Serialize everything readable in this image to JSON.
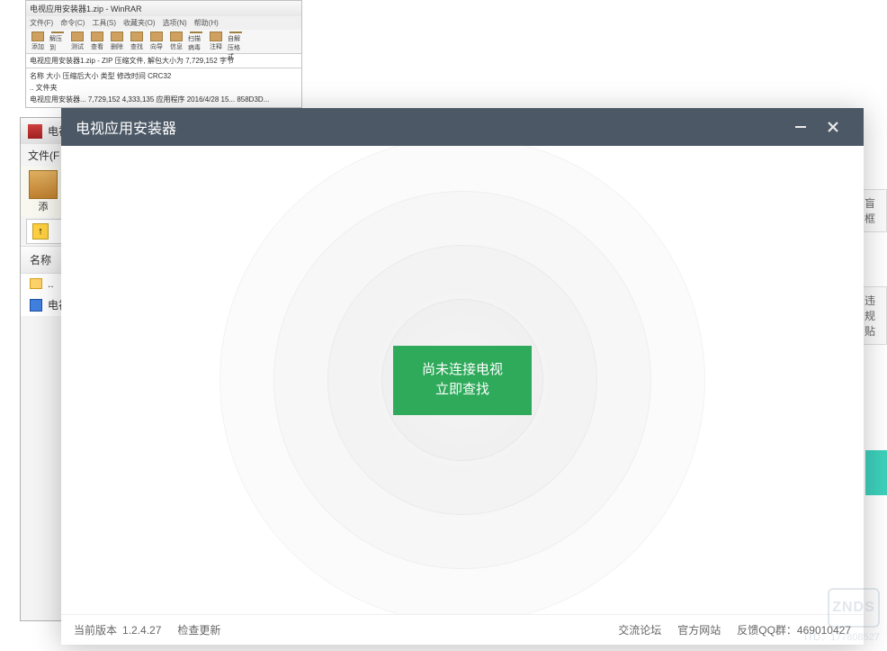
{
  "bg_small": {
    "title": "电视应用安装器1.zip - WinRAR",
    "menu": [
      "文件(F)",
      "命令(C)",
      "工具(S)",
      "收藏夹(O)",
      "选项(N)",
      "帮助(H)"
    ],
    "toolbar": [
      "添加",
      "解压到",
      "测试",
      "查看",
      "删除",
      "查找",
      "向导",
      "信息",
      "扫描病毒",
      "注释",
      "自解压格式"
    ],
    "path": "电视应用安装器1.zip - ZIP 压缩文件, 解包大小为 7,729,152 字节",
    "headers": "名称     大小   压缩后大小   类型         修改时间        CRC32",
    "row1": "..                                   文件夹",
    "row2": "电视应用安装器...   7,729,152   4,333,135   应用程序   2016/4/28 15...   858D3D..."
  },
  "bg_mid": {
    "title": "电视",
    "menu": "文件(F",
    "toolbar_label": "添",
    "header": "名称",
    "row_up": "..",
    "row_file": "电视"
  },
  "right_peek": {
    "item1": "盲框",
    "item2": "违规贴"
  },
  "modal": {
    "title": "电视应用安装器",
    "connect_line1": "尚未连接电视",
    "connect_line2": "立即查找",
    "footer_version_label": "当前版本",
    "footer_version_value": "1.2.4.27",
    "footer_check_update": "检查更新",
    "footer_forum": "交流论坛",
    "footer_site": "官方网站",
    "footer_qq_label": "反馈QQ群：",
    "footer_qq_value": "469010427"
  },
  "watermark": {
    "logo": "ZNDS",
    "id": "ITD：177808527"
  }
}
